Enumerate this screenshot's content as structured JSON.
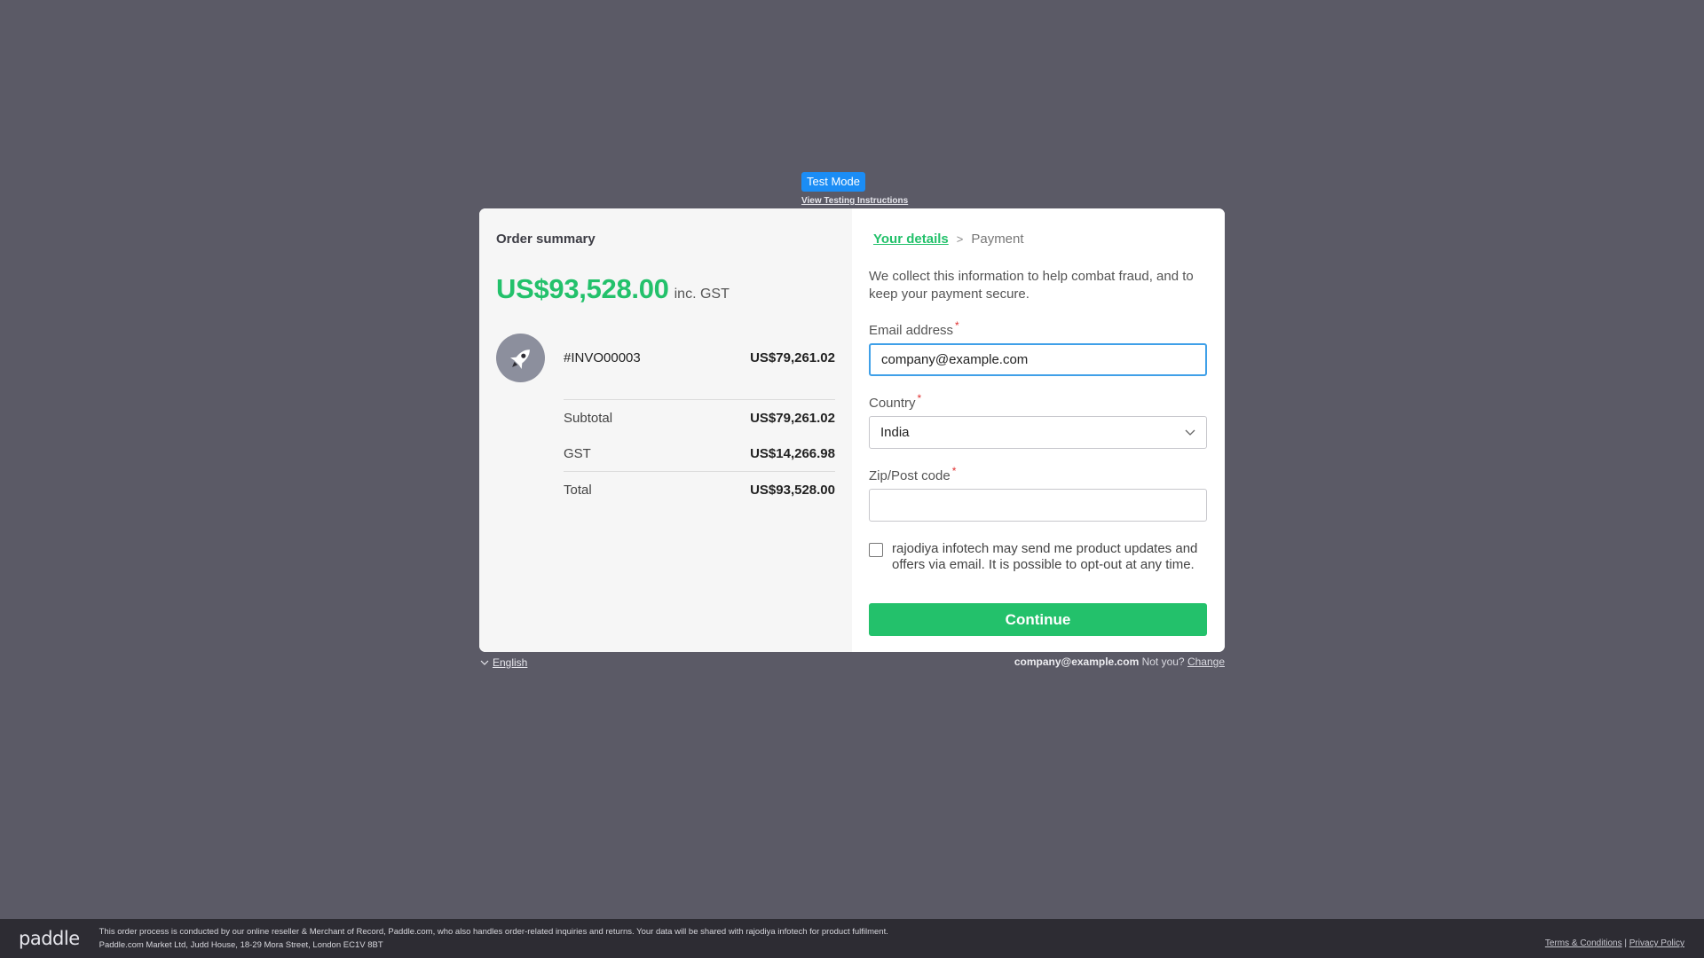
{
  "test_mode": {
    "badge": "Test Mode",
    "instructions_link": "View Testing Instructions"
  },
  "order": {
    "title": "Order summary",
    "total_amount": "US$93,528.00",
    "total_suffix": "inc. GST",
    "item": {
      "icon": "rocket-icon",
      "name": "#INVO00003",
      "price": "US$79,261.02"
    },
    "subtotal_label": "Subtotal",
    "subtotal_value": "US$79,261.02",
    "tax_label": "GST",
    "tax_value": "US$14,266.98",
    "total_label": "Total",
    "total_value": "US$93,528.00"
  },
  "checkout": {
    "breadcrumb_active": "Your details",
    "breadcrumb_separator": ">",
    "breadcrumb_next": "Payment",
    "info": "We collect this information to help combat fraud, and to keep your payment secure.",
    "email_label": "Email address",
    "email_value": "company@example.com",
    "country_label": "Country",
    "country_value": "India",
    "zip_label": "Zip/Post code",
    "zip_value": "",
    "required_marker": "*",
    "marketing_consent": "rajodiya infotech may send me product updates and offers via email. It is possible to opt-out at any time.",
    "marketing_checked": false,
    "continue_label": "Continue"
  },
  "below_modal": {
    "language": "English",
    "account_email": "company@example.com",
    "not_you": "Not you?",
    "change": "Change"
  },
  "footer": {
    "logo": "paddle",
    "line1": "This order process is conducted by our online reseller & Merchant of Record, Paddle.com, who also handles order-related inquiries and returns.  Your data will be shared with rajodiya infotech for product fulfilment.",
    "line2": "Paddle.com Market Ltd, Judd House, 18-29 Mora Street, London EC1V 8BT",
    "terms": "Terms & Conditions",
    "link_separator": "|",
    "privacy": "Privacy Policy"
  },
  "colors": {
    "accent_green": "#23c16b",
    "test_mode_blue": "#1b8df5",
    "backdrop": "#5b5a66"
  }
}
